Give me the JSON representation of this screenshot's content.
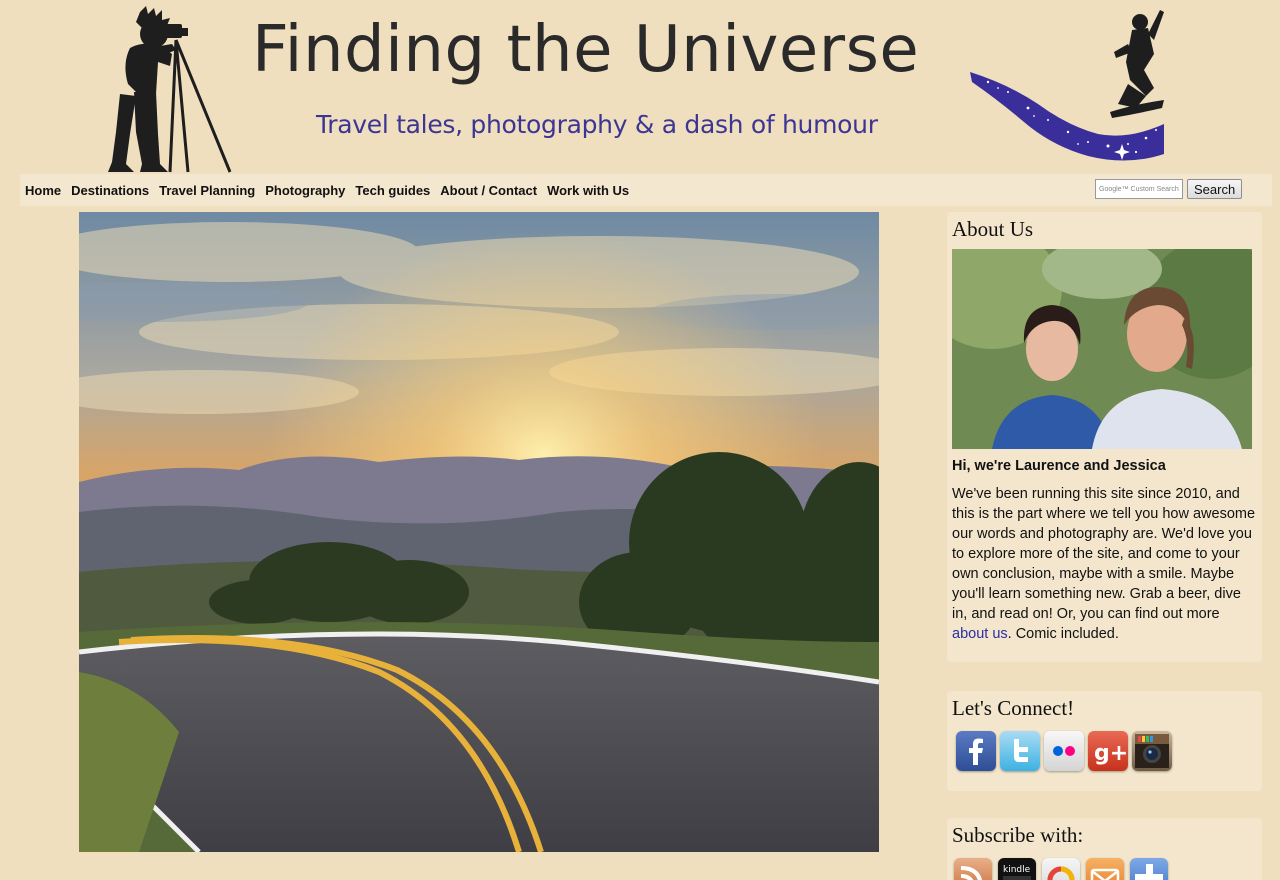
{
  "header": {
    "title": "Finding the Universe",
    "tagline": "Travel tales, photography & a dash of humour"
  },
  "nav": {
    "items": [
      {
        "label": "Home"
      },
      {
        "label": "Destinations"
      },
      {
        "label": "Travel Planning"
      },
      {
        "label": "Photography"
      },
      {
        "label": "Tech guides"
      },
      {
        "label": "About / Contact"
      },
      {
        "label": "Work with Us"
      }
    ],
    "search_placeholder": "Google™ Custom Search",
    "search_button": "Search"
  },
  "sidebar": {
    "about": {
      "title": "About Us",
      "subtitle": "Hi, we're Laurence and Jessica",
      "text_before_link": "We've been running this site since 2010, and this is the part where we tell you how awesome our words and photography are. We'd love you to explore more of the site, and come to your own conclusion, maybe with a smile. Maybe you'll learn something new. Grab a beer, dive in, and read on! Or, you can find out more ",
      "link_text": "about us",
      "text_after_link": ". Comic included."
    },
    "connect": {
      "title": "Let's Connect!",
      "icons": [
        "facebook-icon",
        "twitter-icon",
        "flickr-icon",
        "google-plus-icon",
        "instagram-icon"
      ]
    },
    "subscribe": {
      "title": "Subscribe with:",
      "icons": [
        "rss-icon",
        "kindle-icon",
        "google-reader-icon",
        "email-icon",
        "plus-icon"
      ],
      "kindle_label": "kindle"
    }
  },
  "colors": {
    "background": "#efdfbf",
    "tagline": "#3d3594",
    "link": "#2b2da1"
  }
}
